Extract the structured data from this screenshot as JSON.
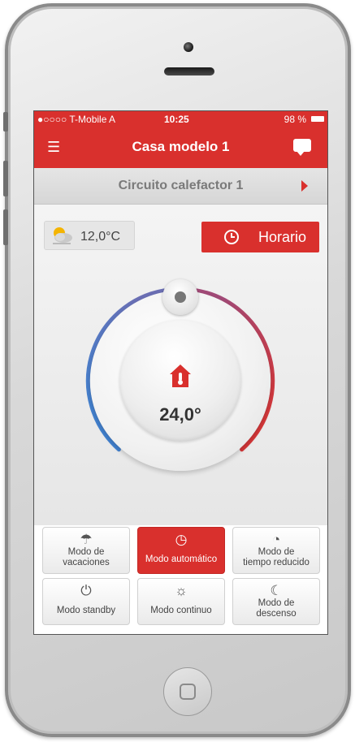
{
  "status_bar": {
    "carrier": "●○○○○ T-Mobile A",
    "time": "10:25",
    "battery": "98 %"
  },
  "nav": {
    "title": "Casa modelo 1",
    "menu_icon": "menu-icon",
    "chat_icon": "chat-icon"
  },
  "circuit": {
    "label": "Circuito calefactor 1",
    "arrow_icon": "arrow-right-icon"
  },
  "weather": {
    "temperature": "12,0°C",
    "icon": "partly-cloudy-icon"
  },
  "schedule_button": {
    "label": "Horario",
    "icon": "clock-icon"
  },
  "dial": {
    "setpoint": "24,0°",
    "icon": "house-thermometer-icon"
  },
  "modes": [
    {
      "line1": "Modo de",
      "line2": "vacaciones",
      "icon": "umbrella-icon",
      "active": false
    },
    {
      "line1": "",
      "line2": "Modo automático",
      "icon": "clock-icon",
      "active": true
    },
    {
      "line1": "Modo de",
      "line2": "tiempo reducido",
      "icon": "half-clock-icon",
      "active": false
    },
    {
      "line1": "",
      "line2": "Modo standby",
      "icon": "power-icon",
      "active": false
    },
    {
      "line1": "",
      "line2": "Modo continuo",
      "icon": "sun-icon",
      "active": false
    },
    {
      "line1": "Modo de",
      "line2": "descenso",
      "icon": "moon-icon",
      "active": false
    }
  ],
  "colors": {
    "accent": "#d9302d",
    "cold": "#3a86d6",
    "hot": "#e0332c"
  }
}
